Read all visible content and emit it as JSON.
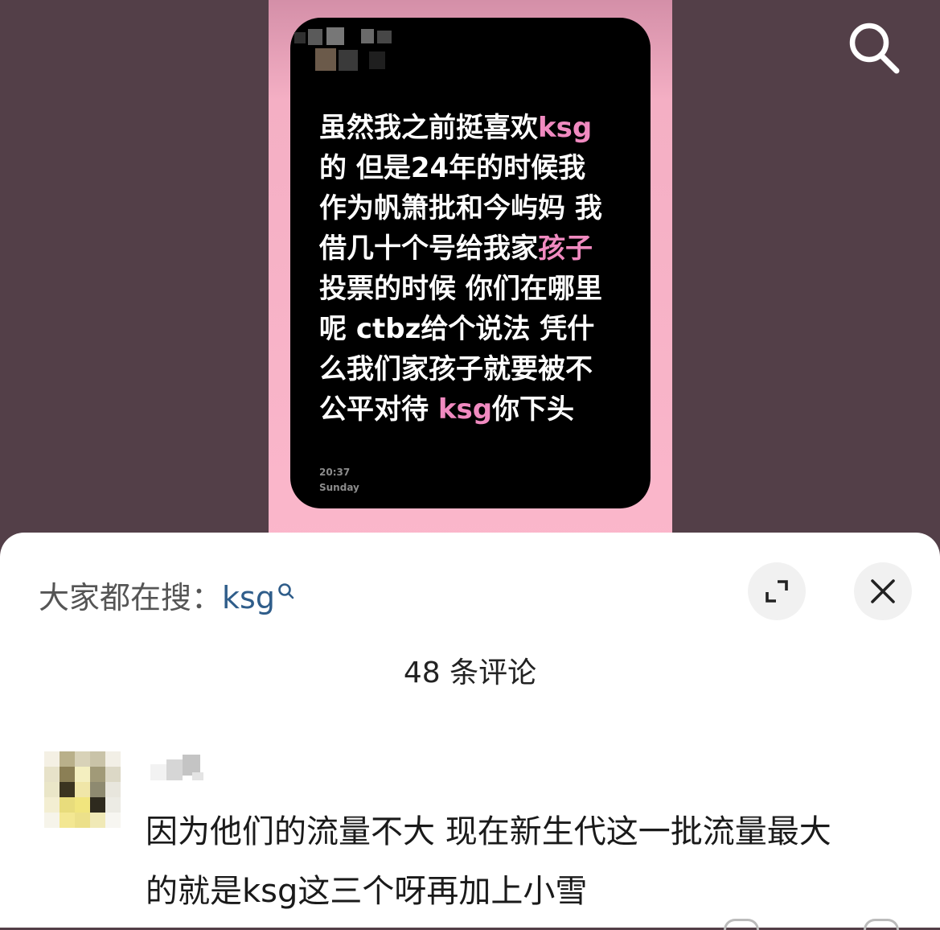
{
  "post": {
    "note_lines": [
      [
        {
          "t": "虽然我之前挺喜欢",
          "hl": false
        },
        {
          "t": "ksg",
          "hl": true
        }
      ],
      [
        {
          "t": "的 但是24年的时候我",
          "hl": false
        }
      ],
      [
        {
          "t": "作为帆箫批和今屿妈 我",
          "hl": false
        }
      ],
      [
        {
          "t": "借几十个号给我家",
          "hl": false
        },
        {
          "t": "孩子",
          "hl": true
        }
      ],
      [
        {
          "t": "投票的时候 你们在哪里",
          "hl": false
        }
      ],
      [
        {
          "t": "呢 ctbz给个说法 凭什",
          "hl": false
        }
      ],
      [
        {
          "t": "么我们家孩子就要被不",
          "hl": false
        }
      ],
      [
        {
          "t": "公平对待 ",
          "hl": false
        },
        {
          "t": "ksg",
          "hl": true
        },
        {
          "t": "你下头",
          "hl": false
        }
      ]
    ],
    "note_time": "20:37",
    "note_day": "Sunday",
    "highlight_color": "#f08ac0"
  },
  "top_bar": {
    "search_icon": "search-icon"
  },
  "sheet": {
    "search_prefix": "大家都在搜：",
    "search_keyword": "ksg",
    "expand_icon": "expand-icon",
    "close_icon": "close-icon",
    "comment_count": "48 条评论",
    "comments": [
      {
        "lines": [
          "因为他们的流量不大 现在新生代这一批流量最大",
          "的就是ksg这三个呀再加上小雪"
        ]
      }
    ],
    "keyword_color": "#2f5d8a"
  }
}
